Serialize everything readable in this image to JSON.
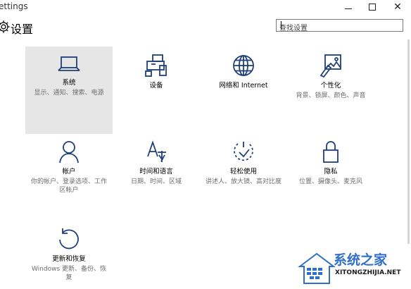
{
  "window": {
    "title": "ettings",
    "minimize_glyph": "—",
    "close_glyph": "✕"
  },
  "header": {
    "title": "设置",
    "gear_icon": "gear-icon"
  },
  "search": {
    "placeholder": "查找设置",
    "value": ""
  },
  "tiles": [
    {
      "name": "系统",
      "desc": "显示、通知、搜索、电源",
      "icon": "laptop-icon",
      "selected": true
    },
    {
      "name": "设备",
      "desc": "",
      "icon": "devices-icon"
    },
    {
      "name": "网络和 Internet",
      "desc": "",
      "icon": "globe-icon"
    },
    {
      "name": "个性化",
      "desc": "背景、锁屏、颜色、声音",
      "icon": "personalization-icon"
    },
    {
      "name": "帐户",
      "desc": "你的帐户、登录选项、工作区帐户",
      "icon": "person-icon"
    },
    {
      "name": "时间和语言",
      "desc": "日期、时间、区域",
      "icon": "time-language-icon"
    },
    {
      "name": "轻松使用",
      "desc": "讲述人、放大镜、高对比度",
      "icon": "ease-of-access-icon"
    },
    {
      "name": "隐私",
      "desc": "位置、摄像头、麦克风",
      "icon": "lock-icon"
    },
    {
      "name": "更新和恢复",
      "desc": "Windows 更新、备份、恢复",
      "icon": "update-icon"
    }
  ],
  "colors": {
    "accent": "#1f3f7a",
    "selected_bg": "#e6e6e6",
    "watermark": "#2f6fc9"
  },
  "watermark": {
    "text": "系统之家",
    "url": "XITONGZHIJIA.NET"
  }
}
